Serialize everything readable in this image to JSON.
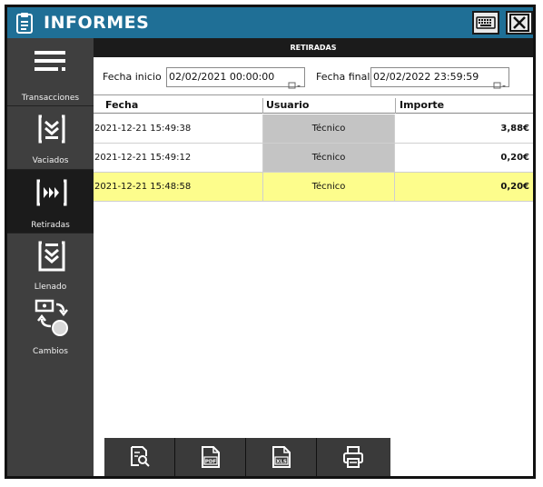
{
  "title": "INFORMES",
  "colors": {
    "titlebar": "#1f6f96",
    "sidebar": "#3f3f3f",
    "sidebar_active": "#1b1b1b",
    "selected_row": "#fdfd8c",
    "user_cell": "#c4c4c4"
  },
  "sidebar": {
    "items": [
      {
        "label": "Transacciones",
        "icon": "hamburger-menu-icon"
      },
      {
        "label": "Vaciados",
        "icon": "empty-down-icon"
      },
      {
        "label": "Retiradas",
        "icon": "fast-forward-icon",
        "active": true
      },
      {
        "label": "Llenado",
        "icon": "fill-down-icon"
      },
      {
        "label": "Cambios",
        "icon": "exchange-icon"
      }
    ]
  },
  "section_header": "RETIRADAS",
  "filters": {
    "start_label": "Fecha inicio",
    "start_value": "02/02/2021 00:00:00",
    "end_label": "Fecha final",
    "end_value": "02/02/2022 23:59:59"
  },
  "table": {
    "headers": [
      "Fecha",
      "Usuario",
      "Importe"
    ],
    "rows": [
      {
        "fecha": "2021-12-21 15:49:38",
        "usuario": "Técnico",
        "importe": "3,88€"
      },
      {
        "fecha": "2021-12-21 15:49:12",
        "usuario": "Técnico",
        "importe": "0,20€"
      },
      {
        "fecha": "2021-12-21 15:48:58",
        "usuario": "Técnico",
        "importe": "0,20€",
        "selected": true
      }
    ]
  },
  "toolbar": {
    "buttons": [
      "preview-icon",
      "pdf-icon",
      "xls-icon",
      "print-icon"
    ],
    "pdf_text": "PDF",
    "xls_text": "XLS"
  }
}
